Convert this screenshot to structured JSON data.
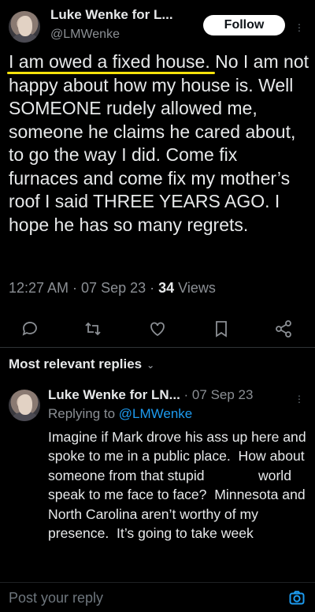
{
  "author": {
    "name": "Luke Wenke for L...",
    "handle": "@LMWenke",
    "follow_label": "Follow"
  },
  "tweet": {
    "highlight": "I am owed a fixed house.",
    "text_rest": "  No I am not happy about how my house is.  Well SOMEONE rudely allowed me, someone he claims he cared about, to go the way I did.  Come fix furnaces and come fix my mother’s roof I said THREE YEARS AGO.  I hope he has so many regrets.",
    "time": "12:27 AM · 07 Sep 23 · ",
    "views_count": "34",
    "views_label": " Views"
  },
  "actions": [
    {
      "name": "reply-icon"
    },
    {
      "name": "retweet-icon"
    },
    {
      "name": "like-icon"
    },
    {
      "name": "bookmark-icon"
    },
    {
      "name": "share-icon"
    }
  ],
  "replies_header": {
    "label": "Most relevant replies",
    "chevron": "⌄"
  },
  "reply": {
    "name": "Luke Wenke for LN...",
    "date": " · 07 Sep 23",
    "replying_prefix": "Replying to ",
    "replying_to": "@LMWenke",
    "text": "Imagine if Mark drove his ass up here and spoke to me in a public place.  How about someone from that stupid              world speak to me face to face?  Minnesota and North Carolina aren’t worthy of my presence.  It’s going to take week"
  },
  "compose": {
    "placeholder": "Post your reply"
  },
  "colors": {
    "background": "#000000",
    "text": "#e7e9ea",
    "secondary": "#8b8f94",
    "accent": "#1d9bf0",
    "highlight": "#f5e20c"
  }
}
